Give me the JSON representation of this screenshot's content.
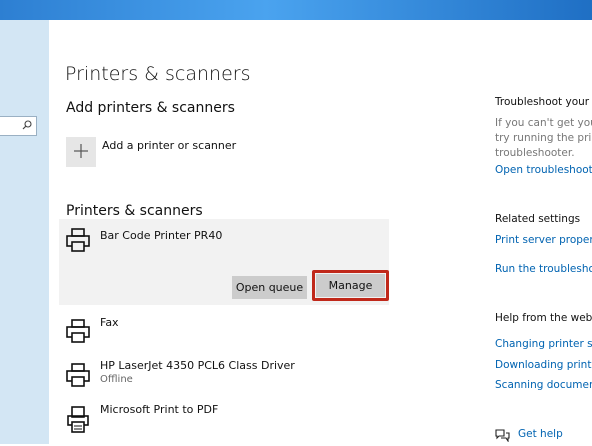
{
  "page": {
    "title": "Printers & scanners"
  },
  "sidebar": {
    "search_icon": "search-icon"
  },
  "add_section": {
    "heading": "Add printers & scanners",
    "add_label": "Add a printer or scanner",
    "add_icon": "plus-icon"
  },
  "printers_section": {
    "heading": "Printers & scanners",
    "printers": [
      {
        "name": "Bar Code Printer PR40",
        "status": "",
        "icon": "printer-icon",
        "selected": true
      },
      {
        "name": "Fax",
        "status": "",
        "icon": "printer-icon"
      },
      {
        "name": "HP LaserJet 4350 PCL6 Class Driver",
        "status": "Offline",
        "icon": "printer-icon"
      },
      {
        "name": "Microsoft Print to PDF",
        "status": "",
        "icon": "pdf-printer-icon"
      }
    ],
    "open_queue_label": "Open queue",
    "manage_label": "Manage",
    "highlight_color": "#c0281a"
  },
  "right_panel": {
    "troubleshoot": {
      "heading": "Troubleshoot your p",
      "lines": [
        "If you can't get your",
        "try running the print",
        "troubleshooter."
      ],
      "link": "Open troubleshoote"
    },
    "related": {
      "heading": "Related settings",
      "links": [
        "Print server properti",
        "Run the troublesho"
      ]
    },
    "help_web": {
      "heading": "Help from the web",
      "links": [
        "Changing printer sta",
        "Downloading print d",
        "Scanning document"
      ]
    },
    "get_help": "Get help"
  },
  "colors": {
    "accent_link": "#0063b1",
    "sidebar_bg": "#d3e6f4",
    "button_bg": "#cccccc"
  }
}
